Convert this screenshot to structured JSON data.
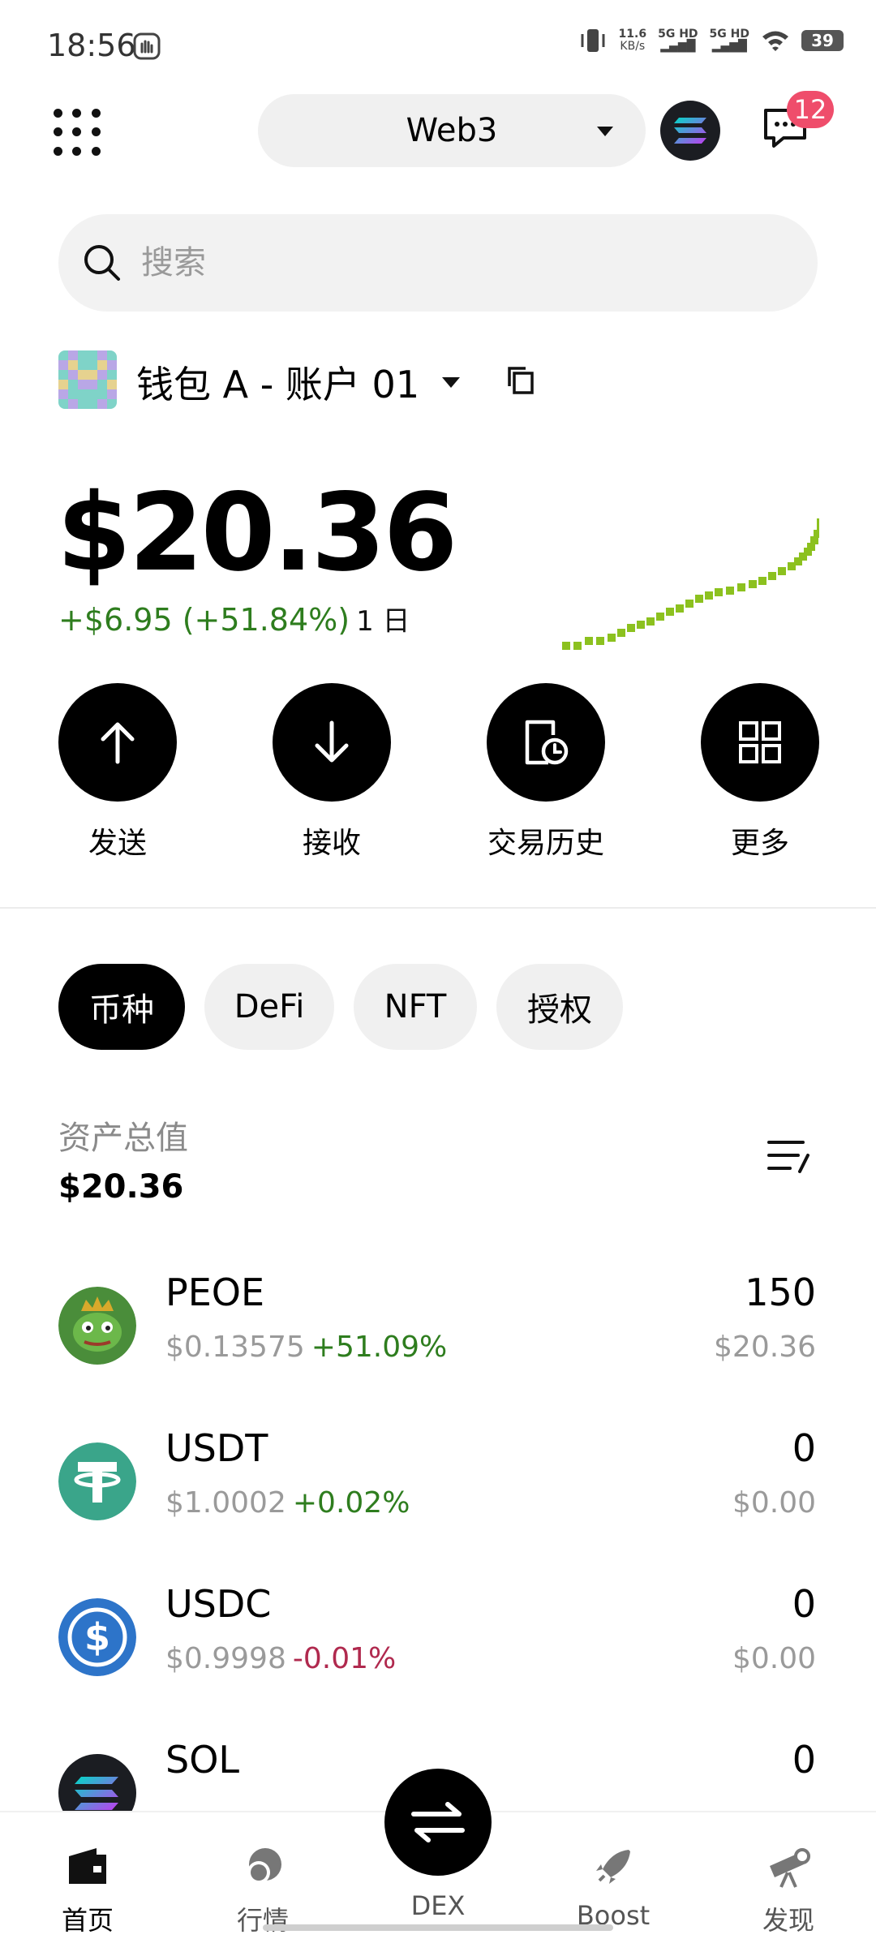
{
  "status_bar": {
    "time": "18:56",
    "net_speed": "11.6",
    "net_unit": "KB/s",
    "sim1": "5G HD",
    "sim2": "5G HD",
    "battery": "39"
  },
  "header": {
    "network": "Web3",
    "badge_count": "12"
  },
  "search": {
    "placeholder": "搜索"
  },
  "wallet": {
    "name": "钱包 A - 账户 01",
    "balance": "$20.36",
    "change": "+$6.95 (+51.84%)",
    "period": "1 日"
  },
  "actions": [
    {
      "label": "发送",
      "icon": "arrow-up-icon"
    },
    {
      "label": "接收",
      "icon": "arrow-down-icon"
    },
    {
      "label": "交易历史",
      "icon": "history-icon"
    },
    {
      "label": "更多",
      "icon": "grid-icon"
    }
  ],
  "tabs": [
    {
      "label": "币种",
      "active": true
    },
    {
      "label": "DeFi",
      "active": false
    },
    {
      "label": "NFT",
      "active": false
    },
    {
      "label": "授权",
      "active": false
    }
  ],
  "assets": {
    "label": "资产总值",
    "total": "$20.36"
  },
  "tokens": [
    {
      "symbol": "PEOE",
      "price": "$0.13575",
      "change": "+51.09%",
      "amount": "150",
      "value": "$20.36"
    },
    {
      "symbol": "USDT",
      "price": "$1.0002",
      "change": "+0.02%",
      "amount": "0",
      "value": "$0.00"
    },
    {
      "symbol": "USDC",
      "price": "$0.9998",
      "change": "-0.01%",
      "amount": "0",
      "value": "$0.00"
    },
    {
      "symbol": "SOL",
      "amount": "0"
    }
  ],
  "bottom_nav": [
    {
      "label": "首页",
      "icon": "wallet-icon"
    },
    {
      "label": "行情",
      "icon": "market-icon"
    },
    {
      "label": "DEX",
      "icon": "swap-icon"
    },
    {
      "label": "Boost",
      "icon": "rocket-icon"
    },
    {
      "label": "发现",
      "icon": "telescope-icon"
    }
  ],
  "colors": {
    "positive": "#2e7d1e",
    "negative": "#b0294e",
    "badge": "#ef4d6b",
    "sparkline": "#8cc11f"
  }
}
